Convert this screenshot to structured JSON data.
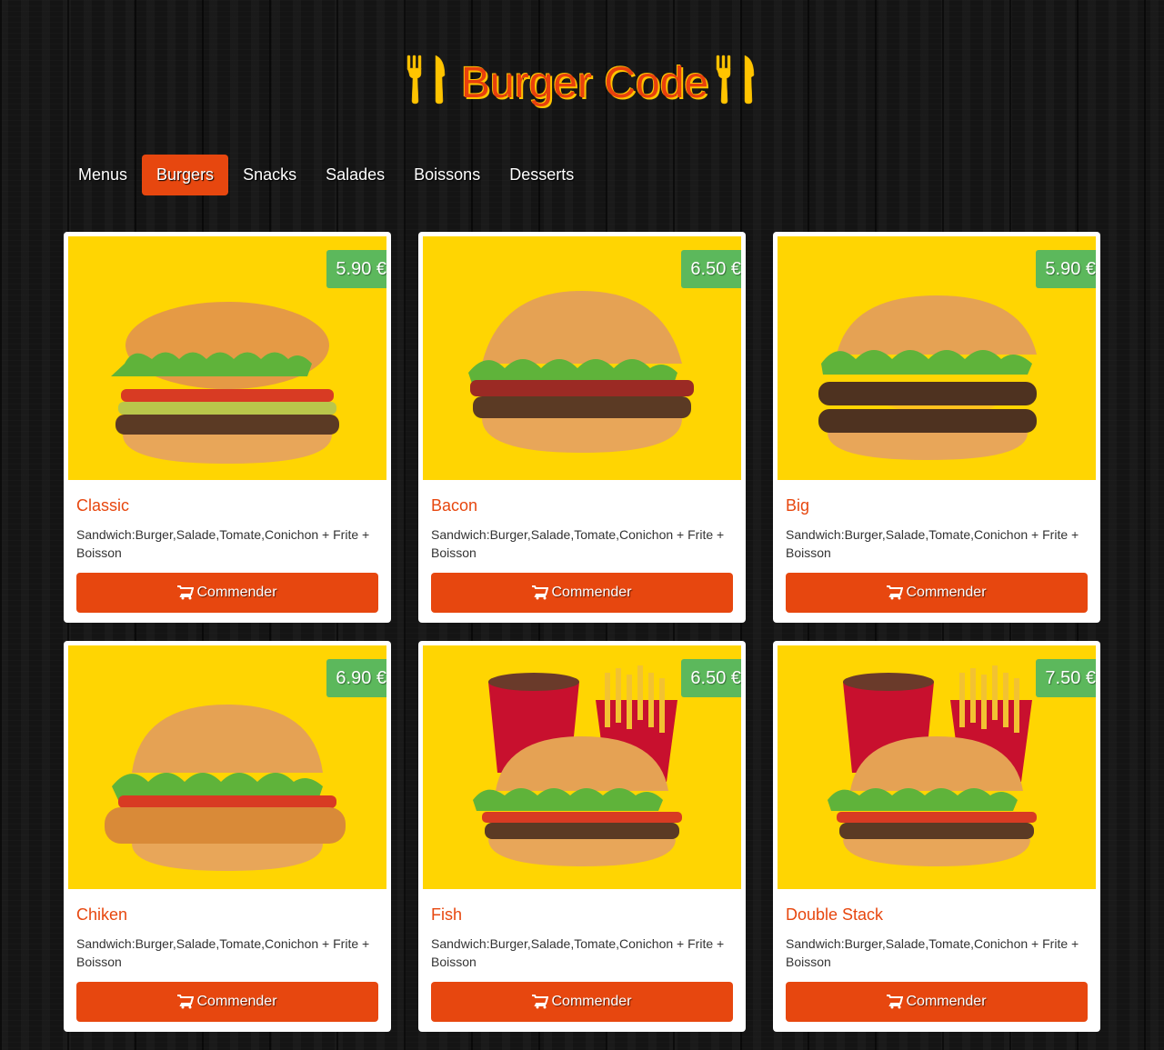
{
  "header": {
    "title": "Burger Code",
    "icon": "fork-knife-icon"
  },
  "nav": {
    "items": [
      "Menus",
      "Burgers",
      "Snacks",
      "Salades",
      "Boissons",
      "Desserts"
    ],
    "active": "Burgers"
  },
  "colors": {
    "accent": "#e7470f",
    "price_badge": "#5cb85c",
    "photo_background": "#ffd502",
    "logo_gold": "#ffc400"
  },
  "products": [
    {
      "name": "Classic",
      "price": "5.90 €",
      "description": "Sandwich:Burger,Salade,Tomate,Conichon + Frite + Boisson",
      "button": "Commender",
      "image": "classic-burger"
    },
    {
      "name": "Bacon",
      "price": "6.50 €",
      "description": "Sandwich:Burger,Salade,Tomate,Conichon + Frite + Boisson",
      "button": "Commender",
      "image": "bacon-burger"
    },
    {
      "name": "Big",
      "price": "5.90 €",
      "description": "Sandwich:Burger,Salade,Tomate,Conichon + Frite + Boisson",
      "button": "Commender",
      "image": "double-cheeseburger"
    },
    {
      "name": "Chiken",
      "price": "6.90 €",
      "description": "Sandwich:Burger,Salade,Tomate,Conichon + Frite + Boisson",
      "button": "Commender",
      "image": "chicken-burger"
    },
    {
      "name": "Fish",
      "price": "6.50 €",
      "description": "Sandwich:Burger,Salade,Tomate,Conichon + Frite + Boisson",
      "button": "Commender",
      "image": "burger-menu-with-drink-and-fries"
    },
    {
      "name": "Double Stack",
      "price": "7.50 €",
      "description": "Sandwich:Burger,Salade,Tomate,Conichon + Frite + Boisson",
      "button": "Commender",
      "image": "burger-menu-with-drink-and-fries"
    }
  ]
}
